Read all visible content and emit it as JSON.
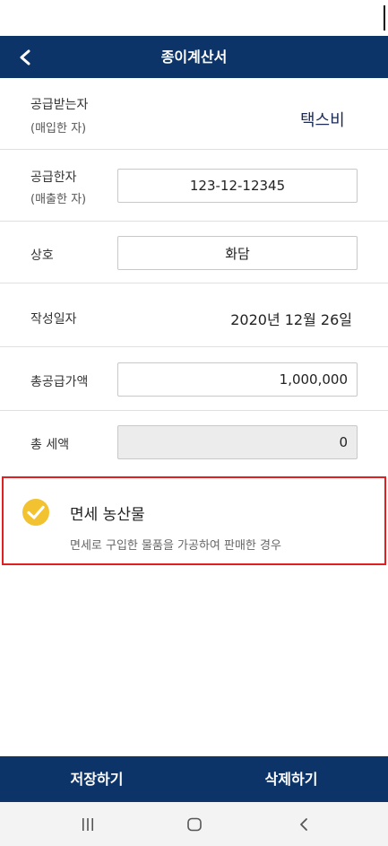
{
  "header": {
    "title": "종이계산서"
  },
  "buyer": {
    "label": "공급받는자",
    "sublabel": "(매입한 자)",
    "value": "택스비"
  },
  "seller": {
    "label": "공급한자",
    "sublabel": "(매출한 자)",
    "value": "123-12-12345"
  },
  "company": {
    "label": "상호",
    "value": "화담"
  },
  "date": {
    "label": "작성일자",
    "value": "2020년 12월 26일"
  },
  "supply": {
    "label": "총공급가액",
    "value": "1,000,000"
  },
  "tax": {
    "label": "총 세액",
    "value": "0"
  },
  "exempt": {
    "checked": true,
    "title": "면세 농산물",
    "description": "면세로 구입한 물품을 가공하여 판매한 경우"
  },
  "actions": {
    "save_label": "저장하기",
    "delete_label": "삭제하기"
  },
  "colors": {
    "primary": "#0c3468",
    "check": "#f2c230",
    "highlight": "#e02020"
  },
  "icons": {
    "back": "chevron-left-icon",
    "check": "check-circle-icon",
    "recents": "recents-icon",
    "home": "home-icon",
    "nav_back": "nav-back-icon"
  }
}
